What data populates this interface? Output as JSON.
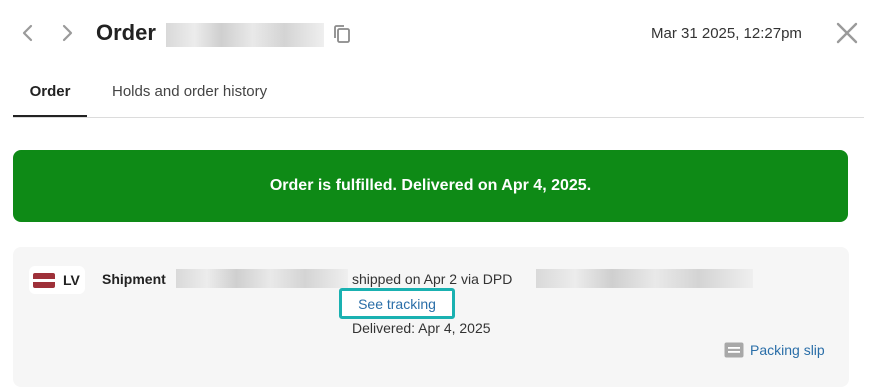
{
  "header": {
    "back_icon": "chevron-left-icon",
    "forward_icon": "chevron-right-icon",
    "title": "Order",
    "copy_icon": "copy-icon",
    "datetime": "Mar 31 2025, 12:27pm",
    "close_icon": "close-icon"
  },
  "tabs": [
    {
      "label": "Order",
      "active": true
    },
    {
      "label": "Holds and order history",
      "active": false
    }
  ],
  "banner": {
    "text": "Order is fulfilled. Delivered on Apr 4, 2025.",
    "color": "#0e8a16"
  },
  "shipment": {
    "country_code": "LV",
    "flag_icon": "latvia-flag-icon",
    "label": "Shipment",
    "status_text": "shipped on Apr 2 via DPD",
    "tracking_link": "See tracking",
    "delivered_text": "Delivered: Apr 4, 2025",
    "packing_slip_icon": "document-icon",
    "packing_slip_label": "Packing slip"
  },
  "colors": {
    "accent_link": "#2a6ea8",
    "highlight_border": "#1ab1b1"
  }
}
